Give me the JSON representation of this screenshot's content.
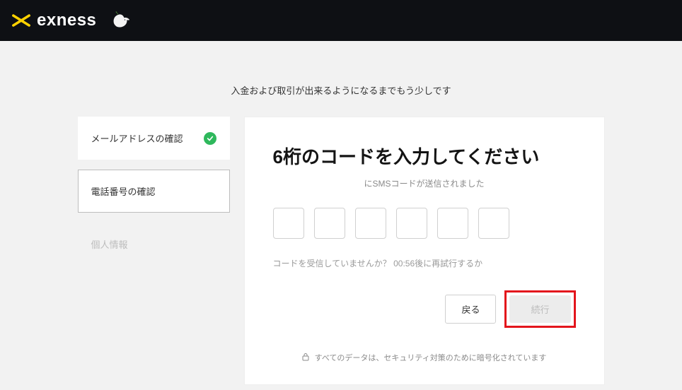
{
  "brand": {
    "name": "exness",
    "accent_color": "#ffd200"
  },
  "progress_text": "入金および取引が出来るようになるまでもう少しです",
  "sidebar": {
    "steps": [
      {
        "label": "メールアドレスの確認",
        "status": "done"
      },
      {
        "label": "電話番号の確認",
        "status": "active"
      },
      {
        "label": "個人情報",
        "status": "disabled"
      }
    ]
  },
  "card": {
    "title": "6桁のコードを入力してください",
    "subtitle": "にSMSコードが送信されました",
    "retry_prefix": "コードを受信していませんか？ ",
    "retry_timer": "00:56",
    "retry_suffix": "後に再試行するか",
    "back_label": "戻る",
    "continue_label": "続行",
    "secure_note": "すべてのデータは、セキュリティ対策のために暗号化されています"
  }
}
